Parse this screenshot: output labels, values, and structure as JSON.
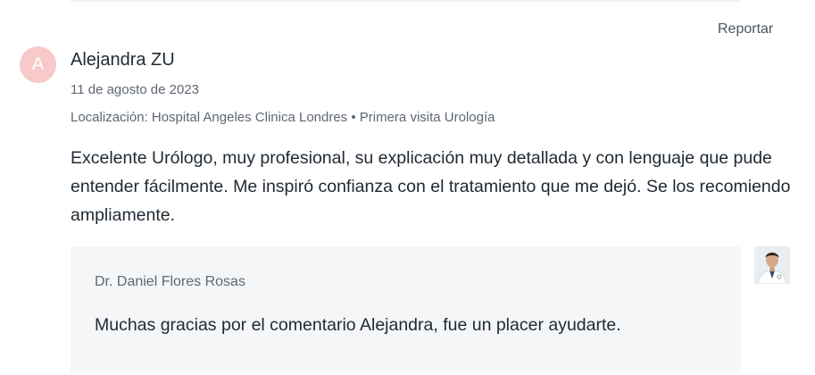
{
  "report": {
    "label": "Reportar"
  },
  "review": {
    "avatar_initial": "A",
    "author": "Alejandra ZU",
    "date": "11 de agosto de 2023",
    "meta": "Localización: Hospital Angeles Clinica Londres • Primera visita Urología",
    "text": "Excelente Urólogo, muy profesional, su explicación muy detallada y con lenguaje que pude entender fácilmente. Me inspiró confianza con el tratamiento que me dejó. Se los recomiendo ampliamente."
  },
  "reply": {
    "doctor_name": "Dr. Daniel Flores Rosas",
    "text": "Muchas gracias por el comentario Alejandra, fue un placer ayudarte."
  },
  "colors": {
    "avatar_bg": "#f8c9c9",
    "reply_bg": "#f5f6f8"
  },
  "icons": {
    "doctor_photo": "doctor-avatar-icon"
  }
}
